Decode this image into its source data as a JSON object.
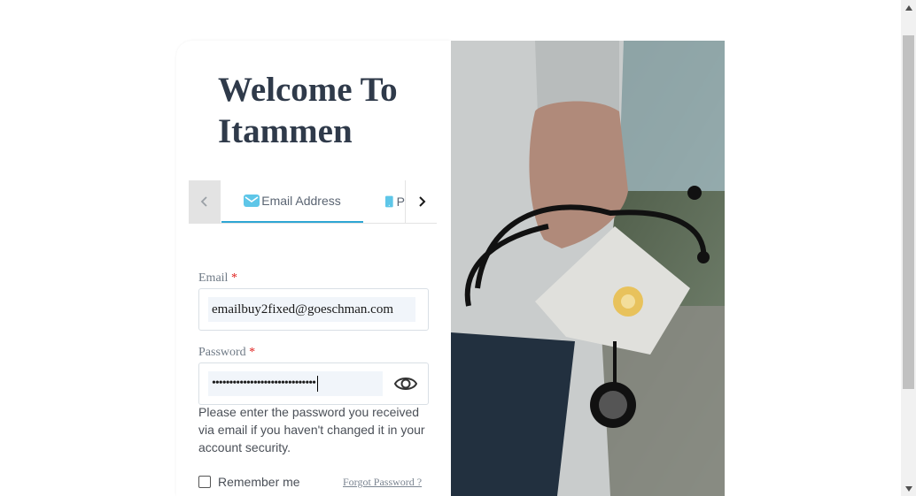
{
  "login": {
    "title": "Welcome To Itammen",
    "tabs": {
      "email_label": "Email Address",
      "phone_label": "P"
    },
    "email": {
      "label": "Email",
      "required": "*",
      "value": "emailbuy2fixed@goeschman.com"
    },
    "password": {
      "label": "Password",
      "required": "*",
      "value": "••••••••••••••••••••••••••••••"
    },
    "help_text": "Please enter the password you received via email if you haven't changed it in your account security.",
    "remember_label": "Remember me",
    "forgot_link": "Forgot Password ?"
  },
  "image": {
    "icon": "doctor-holding-stethoscope-and-mask-photo"
  },
  "colors": {
    "accent": "#2ea6d4",
    "title": "#2f3a4a",
    "required": "#e0201e"
  }
}
